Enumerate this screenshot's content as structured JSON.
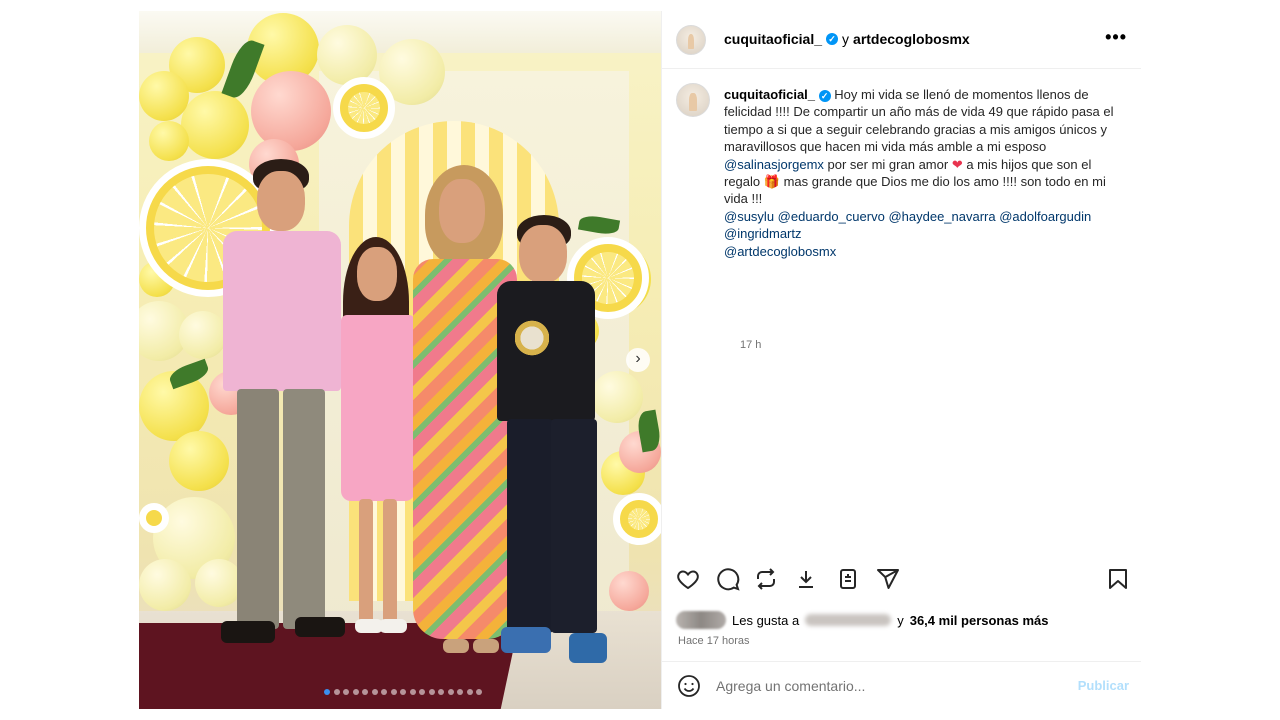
{
  "post": {
    "photo_alt": "",
    "carousel": {
      "total": 17,
      "active_index": 0,
      "next_icon": "chevron-right-icon"
    }
  },
  "header": {
    "author": "cuquitaoficial_",
    "connector": "y",
    "collaborator": "artdecoglobosmx",
    "more_icon": "more-horizontal-icon",
    "more_label": "•••"
  },
  "caption": {
    "author": "cuquitaoficial_",
    "text_1": "Hoy mi vida se llenó de momentos llenos de felicidad !!!! De compartir un año más de vida 49 que rápido pasa el tiempo a si que a seguir celebrando gracias a mis amigos únicos y maravillosos que hacen mi vida más amble a mi esposo",
    "mention_spouse": "@salinasjorgemx",
    "text_2": "por ser mi gran amor",
    "heart_emoji": "❤",
    "text_3": "a mis hijos que son el regalo",
    "gift_emoji": "🎁",
    "text_4": "mas grande que Dios me dio los amo !!!! son todo en mi vida !!!",
    "mentions": [
      "@susylu",
      "@eduardo_cuervo",
      "@haydee_navarra",
      "@adolfoargudin",
      "@ingridmartz",
      "@artdecoglobosmx"
    ],
    "time": "17 h"
  },
  "actions": {
    "like_icon": "heart-icon",
    "comment_icon": "comment-icon",
    "repost_icon": "repost-icon",
    "download_icon": "download-icon",
    "share_embed_icon": "embed-icon",
    "send_icon": "send-icon",
    "save_icon": "bookmark-icon"
  },
  "likes": {
    "prefix": "Les gusta a",
    "conjunction": "y",
    "others": "36,4 mil personas más"
  },
  "posted_ago": "Hace 17 horas",
  "comment": {
    "placeholder": "Agrega un comentario...",
    "publish_label": "Publicar",
    "emoji_icon": "smiley-icon"
  },
  "colors": {
    "link": "#00376b",
    "verified": "#0095f6",
    "publish_disabled": "#b2dffc",
    "carousel_active_dot": "#3a8ff0"
  }
}
